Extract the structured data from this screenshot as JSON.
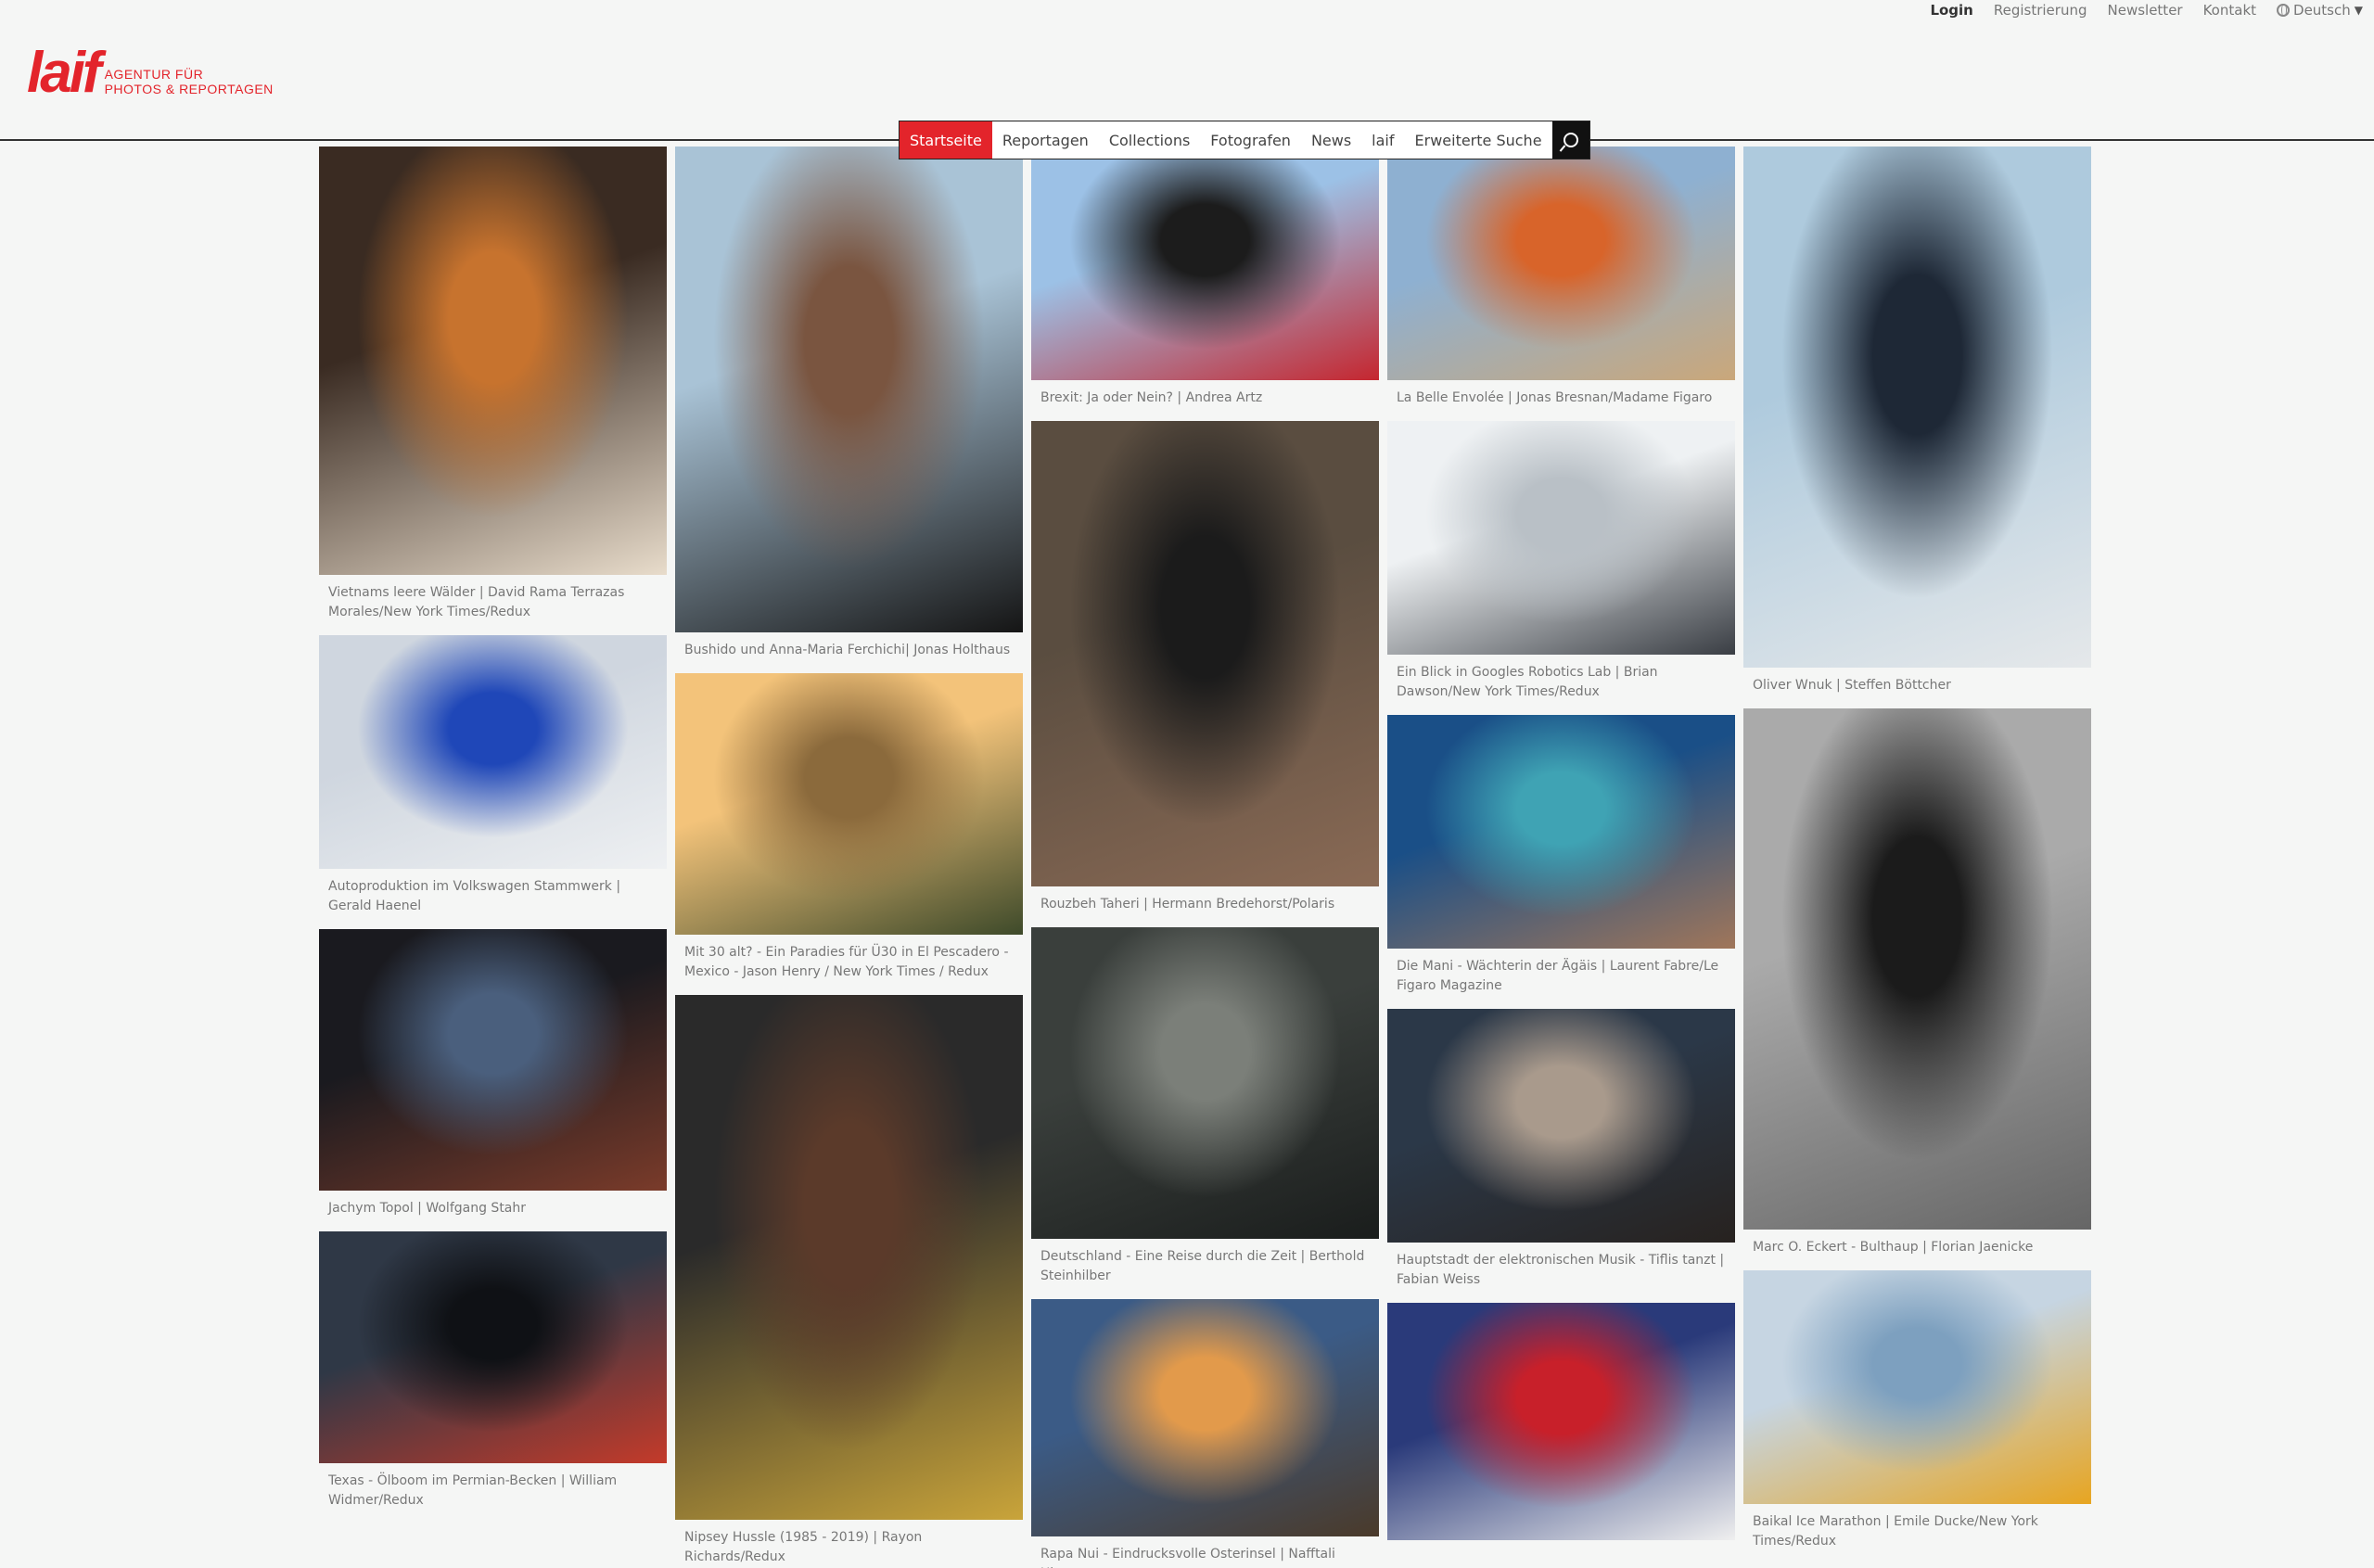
{
  "topbar": {
    "login": "Login",
    "register": "Registrierung",
    "newsletter": "Newsletter",
    "contact": "Kontakt",
    "language": "Deutsch"
  },
  "logo": {
    "word": "laif",
    "tagline_1": "AGENTUR FÜR",
    "tagline_2": "PHOTOS & REPORTAGEN"
  },
  "nav": {
    "items": [
      {
        "label": "Startseite",
        "active": true
      },
      {
        "label": "Reportagen"
      },
      {
        "label": "Collections"
      },
      {
        "label": "Fotografen"
      },
      {
        "label": "News"
      },
      {
        "label": "laif"
      },
      {
        "label": "Erweiterte Suche"
      }
    ],
    "search_icon": "search-icon"
  },
  "columns": [
    [
      {
        "caption": "Vietnams leere Wälder | David Rama Terrazas Morales/New York Times/Redux",
        "colors": [
          "#3a2b22",
          "#c7732e",
          "#e8dccb"
        ]
      },
      {
        "caption": "Autoproduktion im Volkswagen Stammwerk | Gerald Haenel",
        "colors": [
          "#cfd6df",
          "#1f47b8",
          "#eef0f2"
        ]
      },
      {
        "caption": "Jachym Topol | Wolfgang Stahr",
        "colors": [
          "#1a1a1f",
          "#4a5f7d",
          "#7a3b2a"
        ]
      },
      {
        "caption": "Texas - Ölboom im Permian-Becken | William Widmer/Redux",
        "colors": [
          "#2f3846",
          "#0f1115",
          "#c43a2a"
        ]
      }
    ],
    [
      {
        "caption": "Bushido und Anna-Maria Ferchichi| Jonas Holthaus",
        "colors": [
          "#a9c3d6",
          "#7a5540",
          "#151515"
        ]
      },
      {
        "caption": "Mit 30 alt? - Ein Paradies für Ü30 in El Pescadero - Mexico - Jason Henry / New York Times / Redux",
        "colors": [
          "#f3c37a",
          "#8b6a3c",
          "#3e4a2a"
        ]
      },
      {
        "caption": "Nipsey Hussle (1985 - 2019) | Rayon Richards/Redux",
        "colors": [
          "#2a2a2a",
          "#5b3a2a",
          "#c9a43a"
        ]
      }
    ],
    [
      {
        "caption": "Brexit: Ja oder Nein? | Andrea Artz",
        "colors": [
          "#9cc1e6",
          "#1c1c1c",
          "#c5262f"
        ]
      },
      {
        "caption": "Rouzbeh Taheri | Hermann Bredehorst/Polaris",
        "colors": [
          "#5a4d40",
          "#1b1b1b",
          "#8a6a55"
        ]
      },
      {
        "caption": "Deutschland - Eine Reise durch die Zeit | Berthold Steinhilber",
        "colors": [
          "#3a3f3c",
          "#7b7f79",
          "#1a1d1c"
        ]
      },
      {
        "caption": "Rapa Nui - Eindrucksvolle Osterinsel | Nafftali Uluue",
        "colors": [
          "#3b5b86",
          "#e29a4b",
          "#4a3a2a"
        ]
      }
    ],
    [
      {
        "caption": "La Belle Envolée | Jonas Bresnan/Madame Figaro",
        "colors": [
          "#8eb0d1",
          "#d8642a",
          "#caa77a"
        ]
      },
      {
        "caption": "Ein Blick in Googles Robotics Lab | Brian Dawson/New York Times/Redux",
        "colors": [
          "#eef1f3",
          "#b9c0c6",
          "#3a3e44"
        ]
      },
      {
        "caption": "Die Mani - Wächterin der Ägäis | Laurent Fabre/Le Figaro Magazine",
        "colors": [
          "#1a4f87",
          "#3fa3b4",
          "#a0765a"
        ]
      },
      {
        "caption": "Hauptstadt der elektronischen Musik - Tiflis tanzt | Fabian Weiss",
        "colors": [
          "#2b3848",
          "#a99a8c",
          "#27221f"
        ]
      },
      {
        "caption": "",
        "colors": [
          "#2a3a7a",
          "#c8202a",
          "#efefef"
        ]
      }
    ],
    [
      {
        "caption": "Oliver Wnuk | Steffen Böttcher",
        "colors": [
          "#aecadd",
          "#1e2836",
          "#e5e8ea"
        ]
      },
      {
        "caption": "Marc O. Eckert - Bulthaup | Florian Jaenicke",
        "colors": [
          "#aaaaaa",
          "#1b1b1b",
          "#666666"
        ]
      },
      {
        "caption": "Baikal Ice Marathon | Emile Ducke/New York Times/Redux",
        "colors": [
          "#c6d5e2",
          "#7da0bf",
          "#e7a521"
        ]
      }
    ]
  ]
}
